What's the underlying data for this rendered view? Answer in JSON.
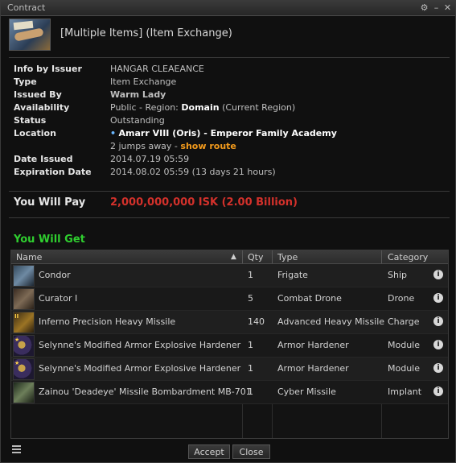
{
  "window": {
    "title": "Contract"
  },
  "header": {
    "title": "[Multiple Items] (Item Exchange)"
  },
  "info": {
    "info_by_issuer": {
      "label": "Info by Issuer",
      "value": "HANGAR CLEAEANCE"
    },
    "type": {
      "label": "Type",
      "value": "Item Exchange"
    },
    "issued_by": {
      "label": "Issued By",
      "value": "Warm Lady"
    },
    "availability": {
      "label": "Availability",
      "prefix": "Public - Region: ",
      "region": "Domain",
      "suffix": " (Current Region)"
    },
    "status": {
      "label": "Status",
      "value": "Outstanding"
    },
    "location": {
      "label": "Location",
      "station": "Amarr VIII (Oris) - Emperor Family Academy",
      "jumps": "2 jumps away - ",
      "route_link": "show route"
    },
    "date_issued": {
      "label": "Date Issued",
      "value": "2014.07.19 05:59"
    },
    "expiration": {
      "label": "Expiration Date",
      "value": "2014.08.02 05:59 (13 days 21 hours)"
    }
  },
  "pay": {
    "label": "You Will Pay",
    "value": "2,000,000,000 ISK (2.00 Billion)"
  },
  "get": {
    "label": "You Will Get"
  },
  "table": {
    "headers": {
      "name": "Name",
      "qty": "Qty",
      "type": "Type",
      "category": "Category"
    },
    "rows": [
      {
        "name": "Condor",
        "qty": "1",
        "type": "Frigate",
        "category": "Ship",
        "icon": "ship-icon"
      },
      {
        "name": "Curator I",
        "qty": "5",
        "type": "Combat Drone",
        "category": "Drone",
        "icon": "drone-icon"
      },
      {
        "name": "Inferno Precision Heavy Missile",
        "qty": "140",
        "type": "Advanced Heavy Missile",
        "category": "Charge",
        "icon": "missile-icon"
      },
      {
        "name": "Selynne's Modified Armor Explosive Hardener",
        "qty": "1",
        "type": "Armor Hardener",
        "category": "Module",
        "icon": "armor-hardener-icon"
      },
      {
        "name": "Selynne's Modified Armor Explosive Hardener",
        "qty": "1",
        "type": "Armor Hardener",
        "category": "Module",
        "icon": "armor-hardener-icon"
      },
      {
        "name": "Zainou 'Deadeye' Missile Bombardment MB-701",
        "qty": "1",
        "type": "Cyber Missile",
        "category": "Implant",
        "icon": "implant-icon"
      }
    ]
  },
  "buttons": {
    "accept": "Accept",
    "close": "Close"
  },
  "colors": {
    "pay": "#d3312b",
    "get": "#2fce2f",
    "link": "#f29a1c"
  }
}
